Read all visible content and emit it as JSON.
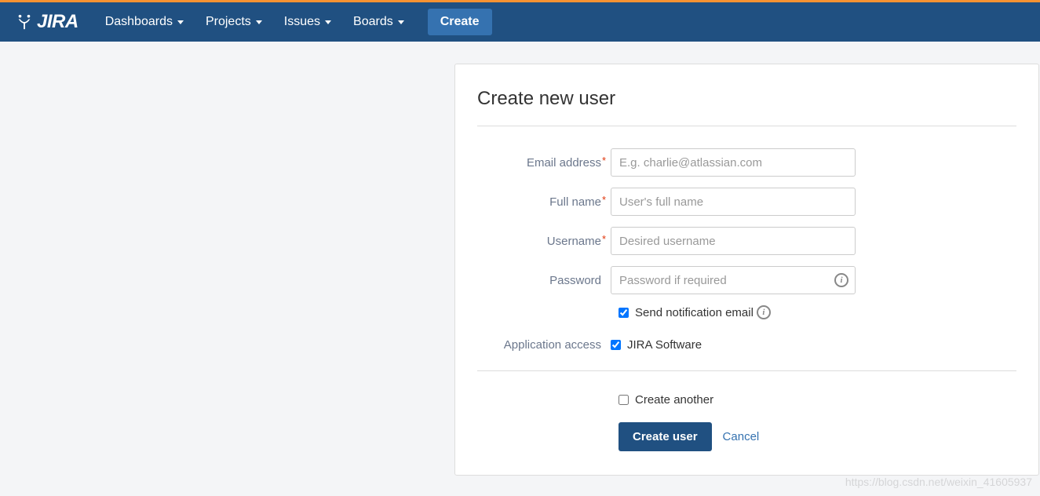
{
  "brand": "JIRA",
  "nav": {
    "items": [
      "Dashboards",
      "Projects",
      "Issues",
      "Boards"
    ],
    "create": "Create"
  },
  "panel": {
    "title": "Create new user",
    "fields": {
      "email": {
        "label": "Email address",
        "placeholder": "E.g. charlie@atlassian.com"
      },
      "fullname": {
        "label": "Full name",
        "placeholder": "User's full name"
      },
      "username": {
        "label": "Username",
        "placeholder": "Desired username"
      },
      "password": {
        "label": "Password",
        "placeholder": "Password if required"
      }
    },
    "send_notification": {
      "label": "Send notification email",
      "checked": true
    },
    "app_access": {
      "label": "Application access",
      "option": "JIRA Software",
      "checked": true
    },
    "create_another": {
      "label": "Create another",
      "checked": false
    },
    "submit": "Create user",
    "cancel": "Cancel"
  },
  "watermark": "https://blog.csdn.net/weixin_41605937"
}
